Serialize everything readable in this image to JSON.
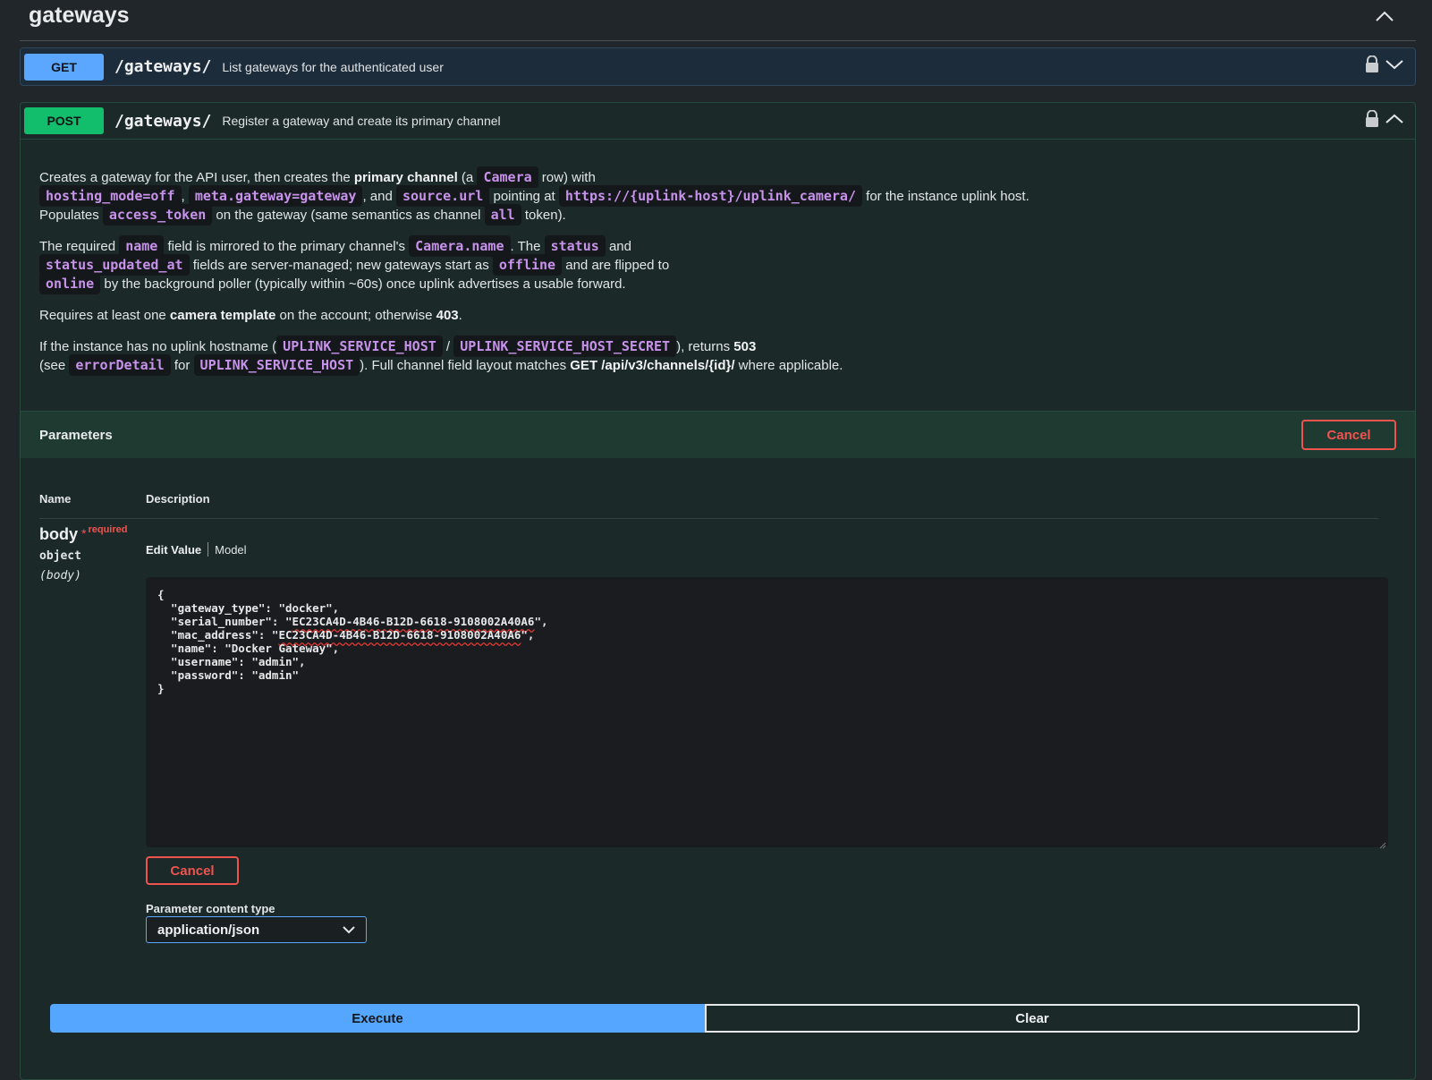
{
  "tag": {
    "title": "gateways"
  },
  "get_op": {
    "method": "GET",
    "path": "/gateways/",
    "summary": "List gateways for the authenticated user"
  },
  "post_op": {
    "method": "POST",
    "path": "/gateways/",
    "summary": "Register a gateway and create its primary channel"
  },
  "description": {
    "p1": {
      "t1": "Creates a gateway for the API user, then creates the ",
      "b1": "primary channel",
      "t2": " (a ",
      "c1": "Camera",
      "t3": " row) with",
      "c2": "hosting_mode=off",
      "t4": ", ",
      "c3": "meta.gateway=gateway",
      "t5": ", and ",
      "c4": "source.url",
      "t6": " pointing at ",
      "c5": "https://{uplink-host}/uplink_camera/",
      "t7": " for the instance uplink host.",
      "t8": "Populates ",
      "c6": "access_token",
      "t9": " on the gateway (same semantics as channel ",
      "c7": "all",
      "t10": " token)."
    },
    "p2": {
      "t1": "The required ",
      "c1": "name",
      "t2": " field is mirrored to the primary channel's ",
      "c2": "Camera.name",
      "t3": ". The ",
      "c3": "status",
      "t4": " and",
      "c4": "status_updated_at",
      "t5": " fields are server-managed; new gateways start as ",
      "c5": "offline",
      "t6": " and are flipped to",
      "c6": "online",
      "t7": " by the background poller (typically within ~60s) once uplink advertises a usable forward."
    },
    "p3": {
      "t1": "Requires at least one ",
      "b1": "camera template",
      "t2": " on the account; otherwise ",
      "b2": "403",
      "t3": "."
    },
    "p4": {
      "t1": "If the instance has no uplink hostname (",
      "c1": "UPLINK_SERVICE_HOST",
      "t2": " / ",
      "c2": "UPLINK_SERVICE_HOST_SECRET",
      "t3": "), returns ",
      "b1": "503",
      "t4": "(see ",
      "c3": "errorDetail",
      "t5": " for ",
      "c4": "UPLINK_SERVICE_HOST",
      "t6": "). Full channel field layout matches ",
      "b2": "GET /api/v3/channels/{id}/",
      "t7": " where applicable."
    }
  },
  "parameters": {
    "title": "Parameters",
    "cancel_label": "Cancel",
    "col_name": "Name",
    "col_description": "Description",
    "param": {
      "name": "body",
      "star": "*",
      "required": "required",
      "type": "object",
      "in": "(body)"
    },
    "tabs": {
      "edit_value": "Edit Value",
      "model": "Model"
    },
    "editor": {
      "open": "{",
      "l1": "  \"gateway_type\": \"docker\",",
      "l2a": "  \"serial_number\": \"",
      "l2b": "EC23CA4D-4B46-B12D-6618-9108002A40A6",
      "l2c": "\",",
      "l3a": "  \"mac_address\": \"",
      "l3b": "EC23CA4D-4B46-B12D-6618-9108002A40A6",
      "l3c": "\",",
      "l4": "  \"name\": \"Docker Gateway\",",
      "l5": "  \"username\": \"admin\",",
      "l6": "  \"password\": \"admin\"",
      "close": "}"
    },
    "cancel_bottom_label": "Cancel",
    "content_type_label": "Parameter content type",
    "content_type_value": "application/json"
  },
  "actions": {
    "execute": "Execute",
    "clear": "Clear"
  },
  "colors": {
    "get": "#5ba6ff",
    "post": "#12bd6b",
    "cancel": "#ef5350",
    "code": "#c792ea"
  }
}
